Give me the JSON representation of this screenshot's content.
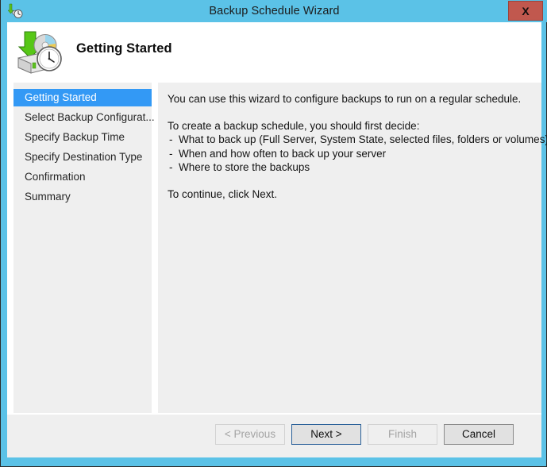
{
  "window": {
    "title": "Backup Schedule Wizard",
    "close_label": "X",
    "frame_color": "#5BC2E7",
    "close_color": "#C1584E"
  },
  "header": {
    "heading": "Getting Started",
    "icon": "backup-schedule-icon"
  },
  "sidebar": {
    "selected_index": 0,
    "accent_color": "#3399F5",
    "items": [
      {
        "label": "Getting Started"
      },
      {
        "label": "Select Backup Configurat..."
      },
      {
        "label": "Specify Backup Time"
      },
      {
        "label": "Specify Destination Type"
      },
      {
        "label": "Confirmation"
      },
      {
        "label": "Summary"
      }
    ]
  },
  "content": {
    "intro": "You can use this wizard to configure backups to run on a regular schedule.",
    "decide_heading": "To create a backup schedule, you should first decide:",
    "bullet_marker": "-",
    "bullets": [
      "What to back up (Full Server, System State, selected files, folders or volumes)",
      "When and how often to back up your server",
      "Where to store the backups"
    ],
    "continue_text": "To continue, click Next."
  },
  "buttons": {
    "previous": {
      "label": "< Previous",
      "state": "disabled"
    },
    "next": {
      "label": "Next >",
      "state": "focused"
    },
    "finish": {
      "label": "Finish",
      "state": "disabled"
    },
    "cancel": {
      "label": "Cancel",
      "state": "enabled"
    }
  }
}
